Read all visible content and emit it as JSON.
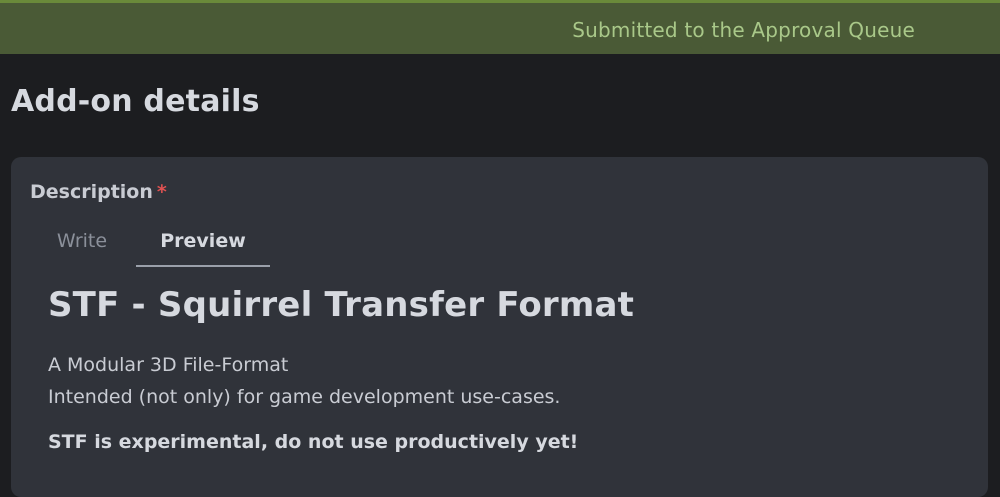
{
  "banner": {
    "message": "Submitted to the Approval Queue"
  },
  "page": {
    "title": "Add-on details"
  },
  "description": {
    "label": "Description",
    "required_marker": "*",
    "tabs": [
      {
        "label": "Write",
        "active": false
      },
      {
        "label": "Preview",
        "active": true
      }
    ],
    "preview": {
      "heading": "STF - Squirrel Transfer Format",
      "lines": [
        "A Modular 3D File-Format",
        "Intended (not only) for game development use-cases."
      ],
      "warning": "STF is experimental, do not use productively yet!"
    }
  },
  "colors": {
    "banner_bg": "#4a5a36",
    "banner_text": "#a9c889",
    "page_bg": "#1c1d20",
    "card_bg": "#30333a",
    "required": "#e05252"
  }
}
